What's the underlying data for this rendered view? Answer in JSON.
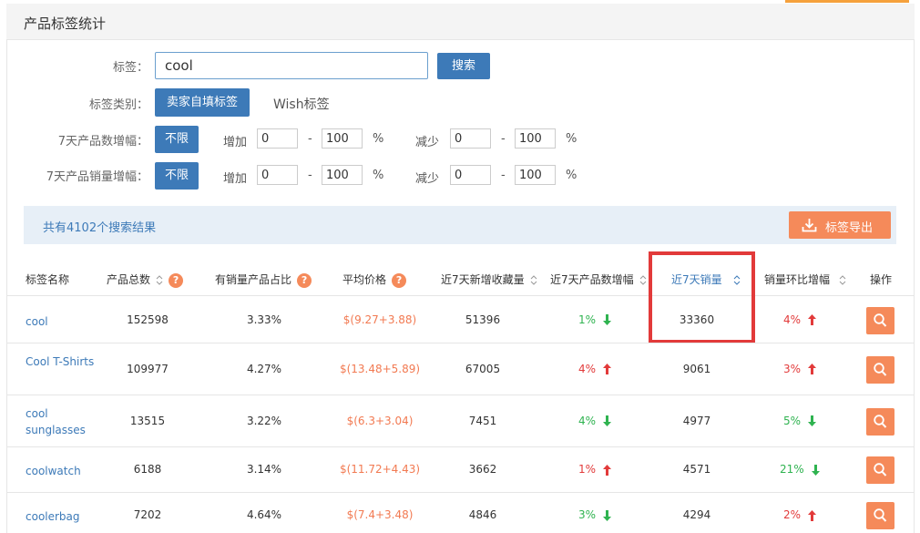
{
  "page": {
    "title": "产品标签统计"
  },
  "filters": {
    "tag_label": "标签：",
    "search_value": "cool",
    "search_button": "搜索",
    "category_label": "标签类别：",
    "category_options": [
      "卖家自填标签",
      "Wish标签"
    ],
    "product_growth_label": "7天产品数增幅：",
    "sales_growth_label": "7天产品销量增幅：",
    "unlimited_button": "不限",
    "increase_label": "增加",
    "decrease_label": "减少",
    "dash": "-",
    "percent": "%",
    "product_growth": {
      "inc_min": "0",
      "inc_max": "100",
      "dec_min": "0",
      "dec_max": "100"
    },
    "sales_growth": {
      "inc_min": "0",
      "inc_max": "100",
      "dec_min": "0",
      "dec_max": "100"
    }
  },
  "results": {
    "summary": "共有4102个搜索结果",
    "export_button": "标签导出"
  },
  "table": {
    "headers": [
      "标签名称",
      "产品总数",
      "有销量产品占比",
      "平均价格",
      "近7天新增收藏量",
      "近7天产品数增幅",
      "近7天销量",
      "销量环比增幅",
      "操作"
    ],
    "active_sort": "近7天销量",
    "rows": [
      {
        "name": "cool",
        "total": "152598",
        "sold_ratio": "3.33%",
        "avg_price": "$(9.27+3.88)",
        "new_fav": "51396",
        "prod_growth": "1%",
        "prod_dir": "down",
        "sales7": "33360",
        "sales_growth": "4%",
        "sales_dir": "up"
      },
      {
        "name": "Cool T-Shirts",
        "total": "109977",
        "sold_ratio": "4.27%",
        "avg_price": "$(13.48+5.89)",
        "new_fav": "67005",
        "prod_growth": "4%",
        "prod_dir": "up",
        "sales7": "9061",
        "sales_growth": "3%",
        "sales_dir": "up"
      },
      {
        "name": "cool sunglasses",
        "total": "13515",
        "sold_ratio": "3.22%",
        "avg_price": "$(6.3+3.04)",
        "new_fav": "7451",
        "prod_growth": "4%",
        "prod_dir": "down",
        "sales7": "4977",
        "sales_growth": "5%",
        "sales_dir": "down"
      },
      {
        "name": "coolwatch",
        "total": "6188",
        "sold_ratio": "3.14%",
        "avg_price": "$(11.72+4.43)",
        "new_fav": "3662",
        "prod_growth": "1%",
        "prod_dir": "up",
        "sales7": "4571",
        "sales_growth": "21%",
        "sales_dir": "down"
      },
      {
        "name": "coolerbag",
        "total": "7202",
        "sold_ratio": "4.64%",
        "avg_price": "$(7.4+3.48)",
        "new_fav": "4846",
        "prod_growth": "3%",
        "prod_dir": "down",
        "sales7": "4294",
        "sales_growth": "2%",
        "sales_dir": "up"
      }
    ]
  },
  "colors": {
    "primary": "#3d7ab8",
    "accent": "#f58a5a",
    "up": "#e23a3a",
    "down": "#2fb350",
    "highlight": "#e23a3a"
  },
  "icons": {
    "sort": "sort-updown-icon",
    "help": "question-icon",
    "export": "download-icon",
    "view": "search-icon"
  }
}
